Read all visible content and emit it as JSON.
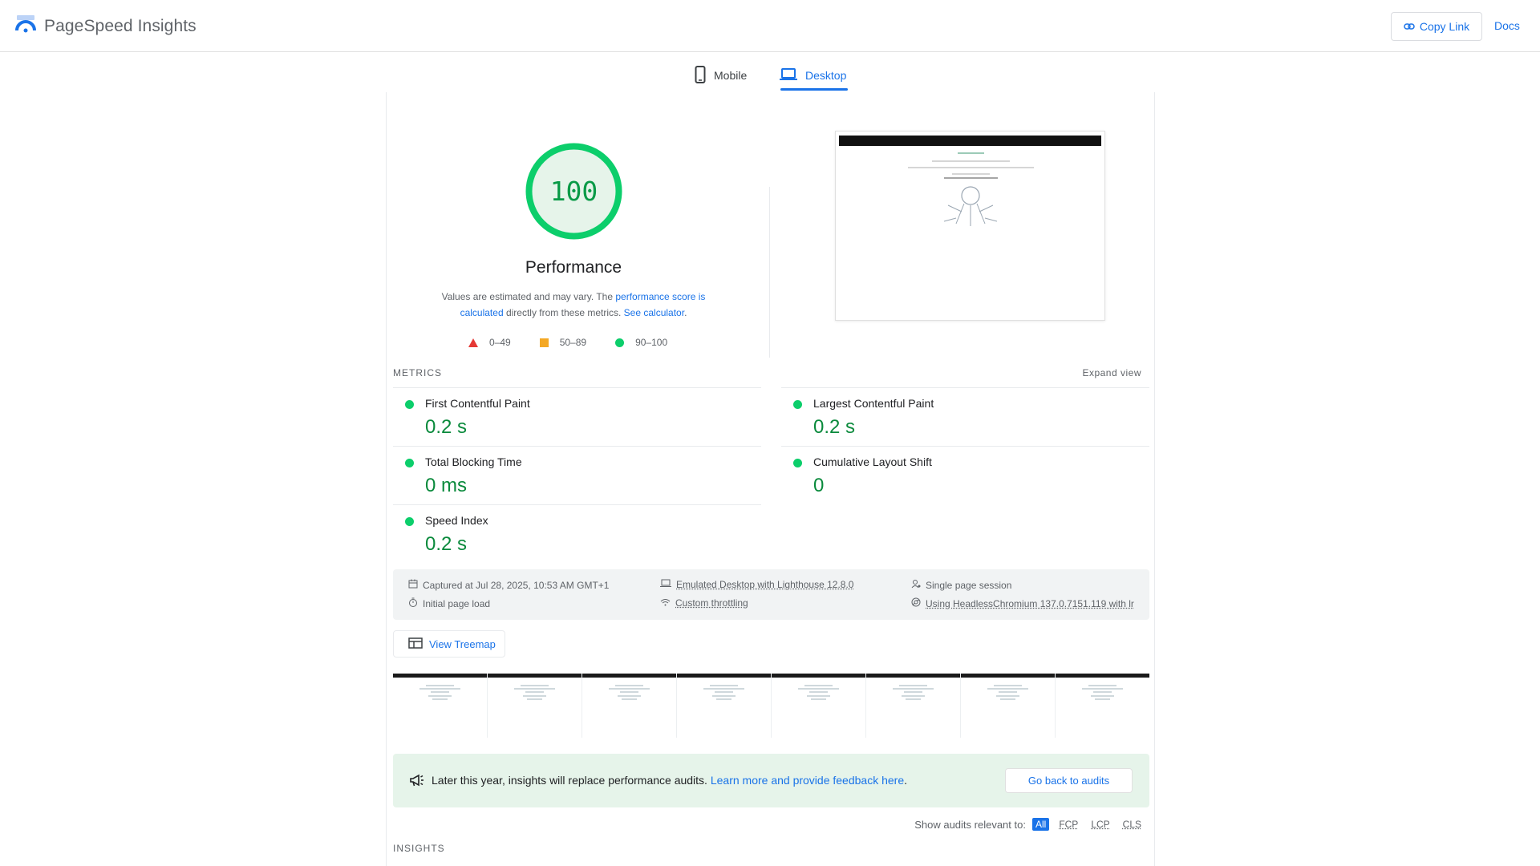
{
  "header": {
    "title": "PageSpeed Insights",
    "copy_link": "Copy Link",
    "docs": "Docs"
  },
  "tabs": [
    {
      "label": "Mobile",
      "icon": "phone-icon",
      "active": false
    },
    {
      "label": "Desktop",
      "icon": "laptop-icon",
      "active": true
    }
  ],
  "score": {
    "value": "100",
    "value_number": 100,
    "label": "Performance",
    "color": "#0cce6b"
  },
  "description": {
    "text1": "Values are estimated and may vary. The ",
    "link1": "performance score is calculated",
    "text2": " directly from these metrics. ",
    "link2": "See calculator",
    "text3": "."
  },
  "legend": [
    {
      "label": "0–49",
      "shape": "triangle",
      "color": "#e53935"
    },
    {
      "label": "50–89",
      "shape": "square",
      "color": "#f4a825"
    },
    {
      "label": "90–100",
      "shape": "circle",
      "color": "#0cce6b"
    }
  ],
  "metrics": {
    "section_label": "METRICS",
    "expand_label": "Expand view",
    "items": [
      {
        "name": "First Contentful Paint",
        "value": "0.2 s"
      },
      {
        "name": "Largest Contentful Paint",
        "value": "0.2 s"
      },
      {
        "name": "Total Blocking Time",
        "value": "0 ms"
      },
      {
        "name": "Cumulative Layout Shift",
        "value": "0"
      },
      {
        "name": "Speed Index",
        "value": "0.2 s"
      }
    ]
  },
  "environment": {
    "captured": "Captured at Jul 28, 2025, 10:53 AM GMT+1",
    "load": "Initial page load",
    "emulated": "Emulated Desktop with Lighthouse 12.8.0",
    "throttling": "Custom throttling",
    "session": "Single page session",
    "browser": "Using HeadlessChromium 137.0.7151.119 with lr"
  },
  "treemap": {
    "label": "View Treemap"
  },
  "filmstrip_frames": 8,
  "notice": {
    "text": "Later this year, insights will replace performance audits. ",
    "link": "Learn more and provide feedback here",
    "after": ".",
    "button": "Go back to audits"
  },
  "audit_filter": {
    "label": "Show audits relevant to:",
    "options": [
      "All",
      "FCP",
      "LCP",
      "CLS"
    ],
    "selected": "All"
  },
  "insights_label": "INSIGHTS"
}
